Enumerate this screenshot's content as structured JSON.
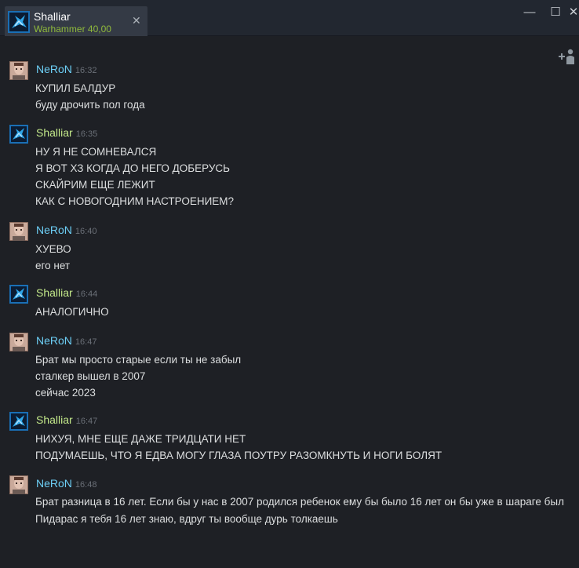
{
  "tab": {
    "name": "Shalliar",
    "game": "Warhammer 40,00",
    "close_glyph": "✕"
  },
  "window_controls": {
    "minimize": "—",
    "maximize": "☐",
    "close": "✕"
  },
  "icons": {
    "invite": "add-friend-icon",
    "avatar_neron": "neron-avatar",
    "avatar_shalliar": "shalliar-avatar"
  },
  "colors": {
    "background": "#1e2025",
    "titlebar": "#222730",
    "tab": "#343a45",
    "game_status": "#90ba3c",
    "author_neron": "#6dcff6",
    "author_shalliar": "#c3e88a",
    "timestamp": "#6b7078",
    "message_text": "#dcdedf"
  },
  "messages": [
    {
      "author": "NeRoN",
      "time": "16:32",
      "lines": [
        "КУПИЛ БАЛДУР",
        "буду дрочить пол года"
      ]
    },
    {
      "author": "Shalliar",
      "time": "16:35",
      "lines": [
        "НУ Я НЕ СОМНЕВАЛСЯ",
        "Я ВОТ ХЗ КОГДА ДО НЕГО ДОБЕРУСЬ",
        "СКАЙРИМ ЕЩЕ ЛЕЖИТ",
        "КАК С НОВОГОДНИМ НАСТРОЕНИЕМ?"
      ]
    },
    {
      "author": "NeRoN",
      "time": "16:40",
      "lines": [
        "ХУЕВО",
        "его нет"
      ]
    },
    {
      "author": "Shalliar",
      "time": "16:44",
      "lines": [
        "АНАЛОГИЧНО"
      ]
    },
    {
      "author": "NeRoN",
      "time": "16:47",
      "lines": [
        "Брат мы просто старые если ты не забыл",
        "сталкер вышел в 2007",
        "сейчас 2023"
      ]
    },
    {
      "author": "Shalliar",
      "time": "16:47",
      "lines": [
        "НИХУЯ, МНЕ ЕЩЕ ДАЖЕ ТРИДЦАТИ НЕТ",
        "ПОДУМАЕШЬ, ЧТО Я ЕДВА МОГУ ГЛАЗА ПОУТРУ РАЗОМКНУТЬ И НОГИ БОЛЯТ"
      ]
    },
    {
      "author": "NeRoN",
      "time": "16:48",
      "lines": [
        "Брат разница в 16 лет. Если бы у нас в 2007 родился ребенок ему бы было 16 лет он бы уже в шараге был",
        "Пидарас я тебя 16 лет знаю, вдруг ты вообще дурь толкаешь"
      ]
    }
  ]
}
